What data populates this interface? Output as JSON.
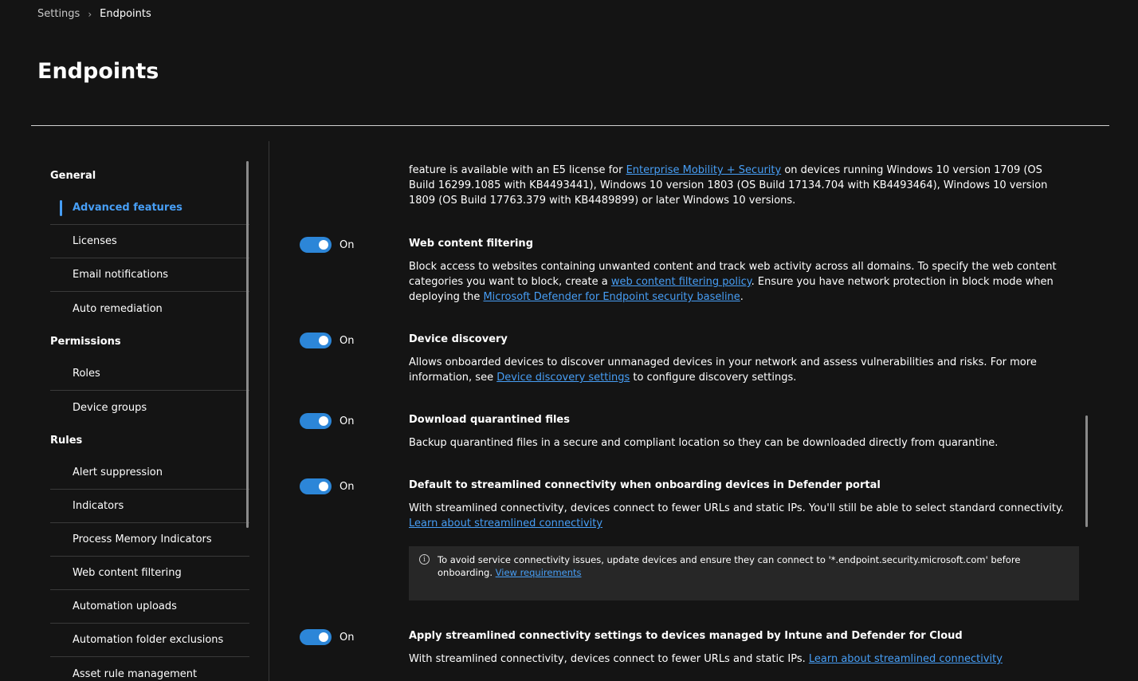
{
  "breadcrumb": {
    "parent": "Settings",
    "separator": "›",
    "current": "Endpoints"
  },
  "page_title": "Endpoints",
  "sidebar": {
    "sections": [
      {
        "label": "General",
        "items": [
          "Advanced features",
          "Licenses",
          "Email notifications",
          "Auto remediation"
        ]
      },
      {
        "label": "Permissions",
        "items": [
          "Roles",
          "Device groups"
        ]
      },
      {
        "label": "Rules",
        "items": [
          "Alert suppression",
          "Indicators",
          "Process Memory Indicators",
          "Web content filtering",
          "Automation uploads",
          "Automation folder exclusions",
          "Asset rule management"
        ]
      }
    ]
  },
  "intro": {
    "text_a": "feature is available with an E5 license for ",
    "link": "Enterprise Mobility + Security",
    "text_b": " on devices running Windows 10 version 1709 (OS Build 16299.1085 with KB4493441), Windows 10 version 1803 (OS Build 17134.704 with KB4493464), Windows 10 version 1809 (OS Build 17763.379 with KB4489899) or later Windows 10 versions."
  },
  "settings": [
    {
      "toggle": "On",
      "title": "Web content filtering",
      "desc_a": "Block access to websites containing unwanted content and track web activity across all domains. To specify the web content categories you want to block, create a ",
      "link_1": "web content filtering policy",
      "desc_b": ". Ensure you have network protection in block mode when deploying the ",
      "link_2": "Microsoft Defender for Endpoint security baseline",
      "desc_c": "."
    },
    {
      "toggle": "On",
      "title": "Device discovery",
      "desc_a": "Allows onboarded devices to discover unmanaged devices in your network and assess vulnerabilities and risks. For more information, see ",
      "link_1": "Device discovery settings",
      "desc_b": " to configure discovery settings."
    },
    {
      "toggle": "On",
      "title": "Download quarantined files",
      "desc_a": "Backup quarantined files in a secure and compliant location so they can be downloaded directly from quarantine."
    },
    {
      "toggle": "On",
      "title": "Default to streamlined connectivity when onboarding devices in Defender portal",
      "desc_a": "With streamlined connectivity, devices connect to fewer URLs and static IPs. You'll still be able to select standard connectivity. ",
      "link_1": "Learn about streamlined connectivity",
      "info": {
        "text": "To avoid service connectivity issues, update devices and ensure they can connect to '*.endpoint.security.microsoft.com' before onboarding. ",
        "link": "View requirements"
      }
    },
    {
      "toggle": "On",
      "title": "Apply streamlined connectivity settings to devices managed by Intune and Defender for Cloud",
      "desc_a": "With streamlined connectivity, devices connect to fewer URLs and static IPs. ",
      "link_1": "Learn about streamlined connectivity"
    }
  ],
  "colors": {
    "accent": "#479ef5",
    "toggle_on": "#2c86d8",
    "background": "#141414"
  }
}
